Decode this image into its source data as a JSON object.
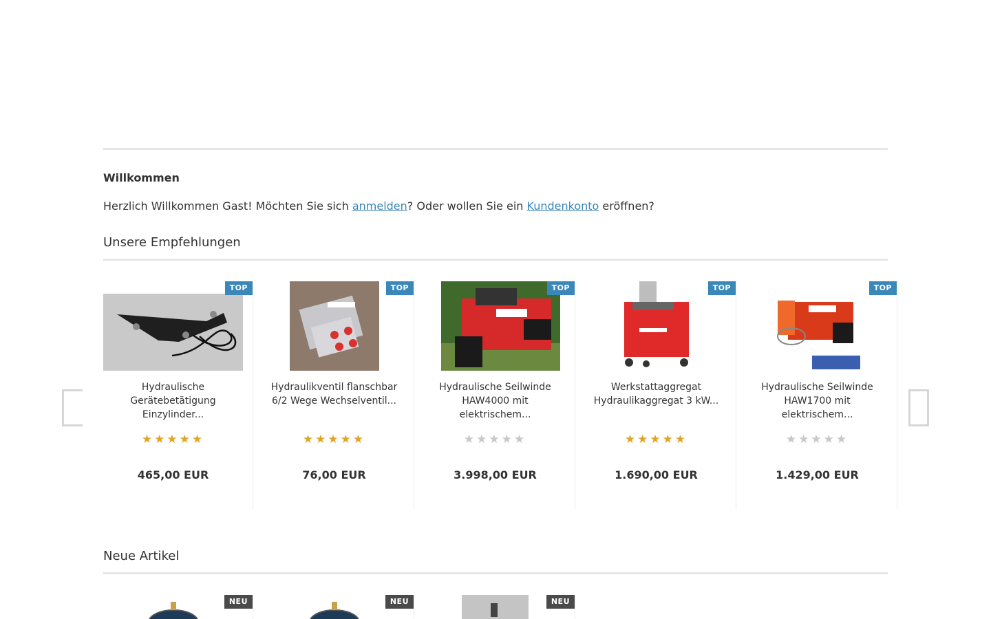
{
  "welcome": {
    "title": "Willkommen",
    "text_before": "Herzlich Willkommen Gast! Möchten Sie sich ",
    "login_link": "anmelden",
    "text_middle": "? Oder wollen Sie ein ",
    "account_link": "Kundenkonto",
    "text_after": " eröffnen?"
  },
  "recommendations": {
    "title": "Unsere Empfehlungen",
    "products": [
      {
        "badge": "TOP",
        "name": "Hydraulische Gerätebetätigung Einzylinder...",
        "rating_stars": 5,
        "rated": true,
        "price": "465,00 EUR",
        "image": "hydraulic-lever-photo"
      },
      {
        "badge": "TOP",
        "name": "Hydraulikventil flanschbar 6/2 Wege Wechselventil...",
        "rating_stars": 5,
        "rated": true,
        "price": "76,00 EUR",
        "image": "valve-photo"
      },
      {
        "badge": "TOP",
        "name": "Hydraulische Seilwinde HAW4000 mit elektrischem...",
        "rating_stars": 5,
        "rated": false,
        "price": "3.998,00 EUR",
        "image": "red-winch-photo"
      },
      {
        "badge": "TOP",
        "name": "Werkstattaggregat Hydraulikaggregat 3 kW...",
        "rating_stars": 5,
        "rated": true,
        "price": "1.690,00 EUR",
        "image": "red-power-unit-photo"
      },
      {
        "badge": "TOP",
        "name": "Hydraulische Seilwinde HAW1700 mit elektrischem...",
        "rating_stars": 5,
        "rated": false,
        "price": "1.429,00 EUR",
        "image": "orange-winch-photo"
      }
    ]
  },
  "new_articles": {
    "title": "Neue Artikel",
    "products": [
      {
        "badge": "NEU",
        "image": "round-gauge-photo"
      },
      {
        "badge": "NEU",
        "image": "round-gauge-photo"
      },
      {
        "badge": "NEU",
        "image": "grey-part-photo"
      }
    ]
  },
  "slider": {
    "prev_icon": "chevron-left-icon",
    "next_icon": "chevron-right-icon"
  },
  "colors": {
    "link": "#3a87b9",
    "badge_top": "#3a87b9",
    "badge_new": "#4a4a4a",
    "star": "#e0a526",
    "star_empty": "#c8c8c8"
  }
}
